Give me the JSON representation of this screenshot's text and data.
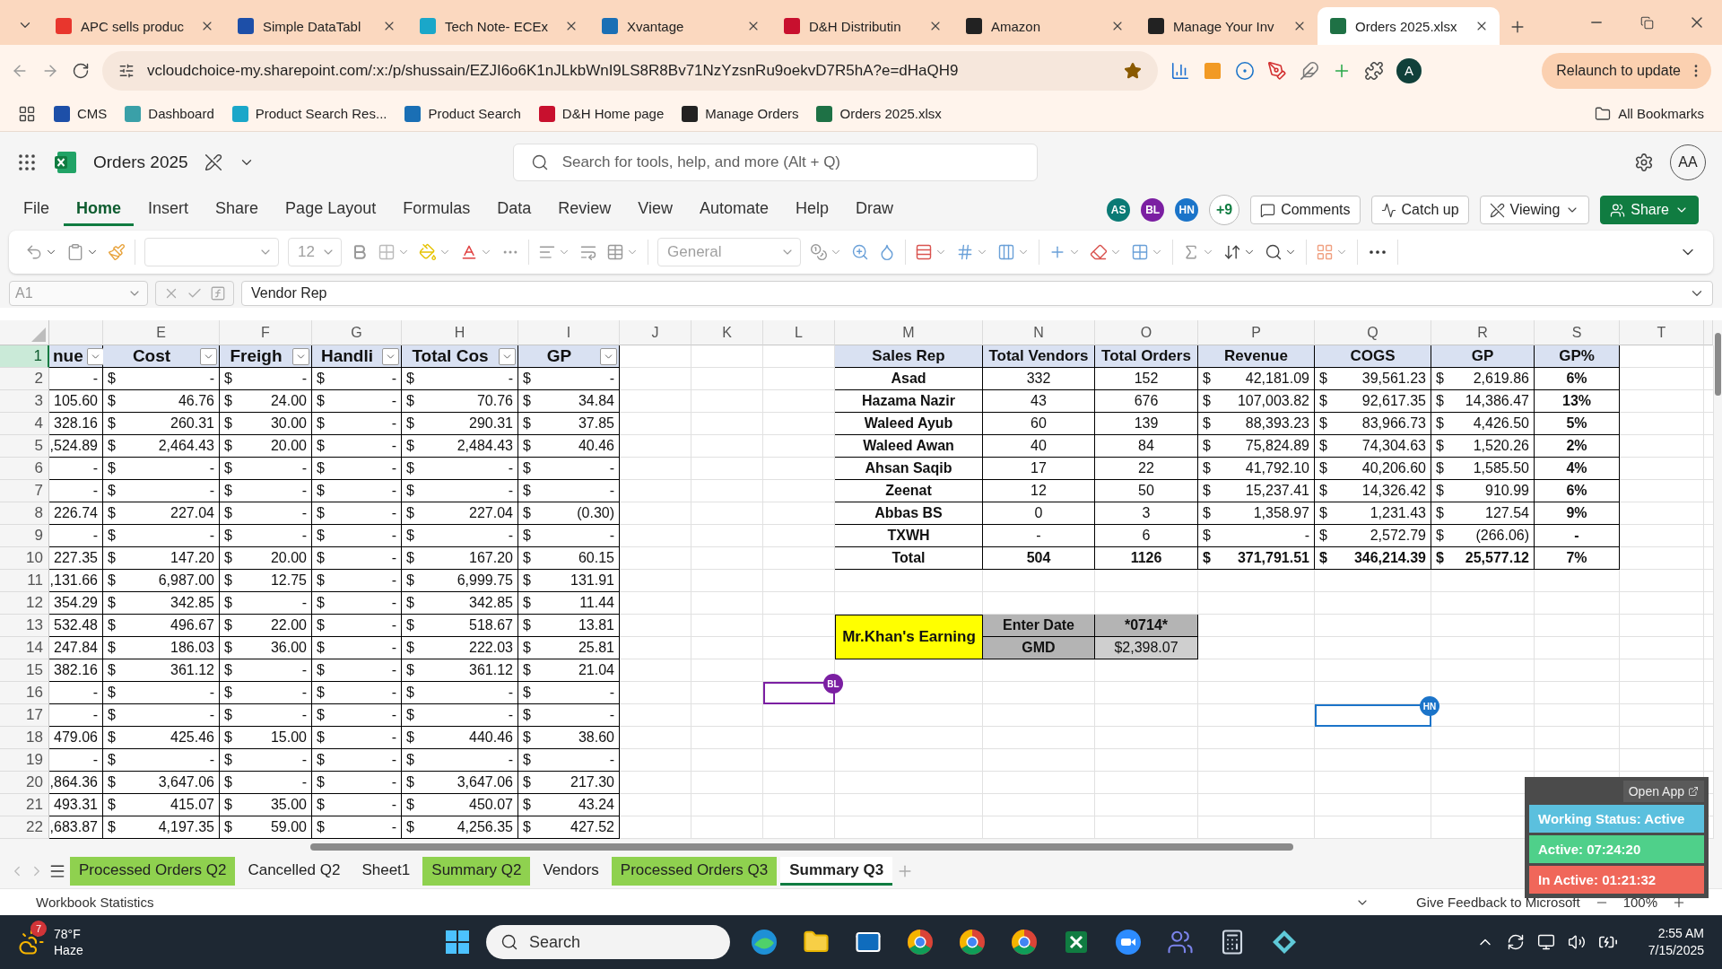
{
  "browser": {
    "tabs": [
      {
        "title": "APC sells produc",
        "color": "#e8362d",
        "selected": false
      },
      {
        "title": "Simple DataTabl",
        "color": "#1d4fa8",
        "selected": false
      },
      {
        "title": "Tech Note- ECEx",
        "color": "#1aa7c9",
        "selected": false
      },
      {
        "title": "Xvantage",
        "color": "#1a6fb5",
        "selected": false
      },
      {
        "title": "D&H Distributin",
        "color": "#c8102e",
        "selected": false
      },
      {
        "title": "Amazon",
        "color": "#222222",
        "selected": false
      },
      {
        "title": "Manage Your Inv",
        "color": "#222222",
        "selected": false
      },
      {
        "title": "Orders 2025.xlsx",
        "color": "#1e7145",
        "selected": true
      }
    ],
    "url": "vcloudchoice-my.sharepoint.com/:x:/p/shussain/EZJI6o6K1nJLkbWnI9LS8R8Bv71NzYzsnRu9oekvD7R5hA?e=dHaQH9",
    "profile": "A",
    "relaunch": "Relaunch to update",
    "bookmarks": [
      {
        "label": "CMS",
        "color": "#1d4fa8"
      },
      {
        "label": "Dashboard",
        "color": "#3aa0a8"
      },
      {
        "label": "Product Search Res...",
        "color": "#1aa7c9"
      },
      {
        "label": "Product Search",
        "color": "#1a6fb5"
      },
      {
        "label": "D&H Home page",
        "color": "#c8102e"
      },
      {
        "label": "Manage Orders",
        "color": "#222222"
      },
      {
        "label": "Orders 2025.xlsx",
        "color": "#1e7145"
      }
    ],
    "all_bookmarks": "All Bookmarks"
  },
  "excel": {
    "file_name": "Orders 2025",
    "search_placeholder": "Search for tools, help, and more (Alt + Q)",
    "account": "AA",
    "menu": [
      {
        "label": "File",
        "selected": false
      },
      {
        "label": "Home",
        "selected": true
      },
      {
        "label": "Insert",
        "selected": false
      },
      {
        "label": "Share",
        "selected": false
      },
      {
        "label": "Page Layout",
        "selected": false
      },
      {
        "label": "Formulas",
        "selected": false
      },
      {
        "label": "Data",
        "selected": false
      },
      {
        "label": "Review",
        "selected": false
      },
      {
        "label": "View",
        "selected": false
      },
      {
        "label": "Automate",
        "selected": false
      },
      {
        "label": "Help",
        "selected": false
      },
      {
        "label": "Draw",
        "selected": false
      }
    ],
    "collaborators": [
      {
        "initials": "AS",
        "color": "#0b7a75"
      },
      {
        "initials": "BL",
        "color": "#7b1fa2"
      },
      {
        "initials": "HN",
        "color": "#1b74c9"
      }
    ],
    "more_collaborators": "+9",
    "actions": [
      "Comments",
      "Catch up",
      "Viewing",
      "Share"
    ],
    "font_size": "12",
    "number_format": "General",
    "name_box": "A1",
    "formula": "Vendor Rep"
  },
  "sheet": {
    "column_letters": [
      "E",
      "F",
      "G",
      "H",
      "I",
      "J",
      "K",
      "L",
      "M",
      "N",
      "O",
      "P",
      "Q",
      "R",
      "S",
      "T"
    ],
    "row_headers": [
      {
        "label": "1",
        "selected": true
      },
      {
        "label": "2",
        "selected": false
      },
      {
        "label": "3",
        "selected": false
      },
      {
        "label": "4",
        "selected": false
      },
      {
        "label": "5",
        "selected": false
      },
      {
        "label": "6",
        "selected": false
      },
      {
        "label": "7",
        "selected": false
      },
      {
        "label": "8",
        "selected": false
      },
      {
        "label": "9",
        "selected": false
      },
      {
        "label": "10",
        "selected": false
      },
      {
        "label": "11",
        "selected": false
      },
      {
        "label": "12",
        "selected": false
      },
      {
        "label": "13",
        "selected": false
      },
      {
        "label": "14",
        "selected": false
      },
      {
        "label": "15",
        "selected": false
      },
      {
        "label": "16",
        "selected": false
      },
      {
        "label": "17",
        "selected": false
      },
      {
        "label": "18",
        "selected": false
      },
      {
        "label": "19",
        "selected": false
      },
      {
        "label": "20",
        "selected": false
      },
      {
        "label": "21",
        "selected": false
      },
      {
        "label": "22",
        "selected": false
      }
    ],
    "data_table": {
      "header": [
        "nue",
        "Cost",
        "Freigh",
        "Handli",
        "Total Cos",
        "GP"
      ],
      "rows": [
        [
          "-",
          "$ -",
          "$ -",
          "$ -",
          "$ -",
          "$ -"
        ],
        [
          "105.60",
          "$ 46.76",
          "$ 24.00",
          "$ -",
          "$ 70.76",
          "$ 34.84"
        ],
        [
          "328.16",
          "$ 260.31",
          "$ 30.00",
          "$ -",
          "$ 290.31",
          "$ 37.85"
        ],
        [
          ",524.89",
          "$ 2,464.43",
          "$ 20.00",
          "$ -",
          "$ 2,484.43",
          "$ 40.46"
        ],
        [
          "-",
          "$ -",
          "$ -",
          "$ -",
          "$ -",
          "$ -"
        ],
        [
          "-",
          "$ -",
          "$ -",
          "$ -",
          "$ -",
          "$ -"
        ],
        [
          "226.74",
          "$ 227.04",
          "$ -",
          "$ -",
          "$ 227.04",
          "$ (0.30)"
        ],
        [
          "-",
          "$ -",
          "$ -",
          "$ -",
          "$ -",
          "$ -"
        ],
        [
          "227.35",
          "$ 147.20",
          "$ 20.00",
          "$ -",
          "$ 167.20",
          "$ 60.15"
        ],
        [
          ",131.66",
          "$ 6,987.00",
          "$ 12.75",
          "$ -",
          "$ 6,999.75",
          "$ 131.91"
        ],
        [
          "354.29",
          "$ 342.85",
          "$ -",
          "$ -",
          "$ 342.85",
          "$ 11.44"
        ],
        [
          "532.48",
          "$ 496.67",
          "$ 22.00",
          "$ -",
          "$ 518.67",
          "$ 13.81"
        ],
        [
          "247.84",
          "$ 186.03",
          "$ 36.00",
          "$ -",
          "$ 222.03",
          "$ 25.81"
        ],
        [
          "382.16",
          "$ 361.12",
          "$ -",
          "$ -",
          "$ 361.12",
          "$ 21.04"
        ],
        [
          "-",
          "$ -",
          "$ -",
          "$ -",
          "$ -",
          "$ -"
        ],
        [
          "-",
          "$ -",
          "$ -",
          "$ -",
          "$ -",
          "$ -"
        ],
        [
          "479.06",
          "$ 425.46",
          "$ 15.00",
          "$ -",
          "$ 440.46",
          "$ 38.60"
        ],
        [
          "-",
          "$ -",
          "$ -",
          "$ -",
          "$ -",
          "$ -"
        ],
        [
          ",864.36",
          "$ 3,647.06",
          "$ -",
          "$ -",
          "$ 3,647.06",
          "$ 217.30"
        ],
        [
          "493.31",
          "$ 415.07",
          "$ 35.00",
          "$ -",
          "$ 450.07",
          "$ 43.24"
        ],
        [
          ",683.87",
          "$ 4,197.35",
          "$ 59.00",
          "$ -",
          "$ 4,256.35",
          "$ 427.52"
        ]
      ]
    },
    "summary": {
      "header": [
        "Sales Rep",
        "Total Vendors",
        "Total Orders",
        "Revenue",
        "COGS",
        "GP",
        "GP%"
      ],
      "rows": [
        [
          "Asad",
          "332",
          "152",
          "$ 42,181.09",
          "$ 39,561.23",
          "$ 2,619.86",
          "6%"
        ],
        [
          "Hazama Nazir",
          "43",
          "676",
          "$ 107,003.82",
          "$ 92,617.35",
          "$ 14,386.47",
          "13%"
        ],
        [
          "Waleed Ayub",
          "60",
          "139",
          "$ 88,393.23",
          "$ 83,966.73",
          "$ 4,426.50",
          "5%"
        ],
        [
          "Waleed Awan",
          "40",
          "84",
          "$ 75,824.89",
          "$ 74,304.63",
          "$ 1,520.26",
          "2%"
        ],
        [
          "Ahsan Saqib",
          "17",
          "22",
          "$ 41,792.10",
          "$ 40,206.60",
          "$ 1,585.50",
          "4%"
        ],
        [
          "Zeenat",
          "12",
          "50",
          "$ 15,237.41",
          "$ 14,326.42",
          "$ 910.99",
          "6%"
        ],
        [
          "Abbas BS",
          "0",
          "3",
          "$ 1,358.97",
          "$ 1,231.43",
          "$ 127.54",
          "9%"
        ],
        [
          "TXWH",
          "-",
          "6",
          "$ -",
          "$ 2,572.79",
          "$ (266.06)",
          "-"
        ]
      ],
      "total": [
        "Total",
        "504",
        "1126",
        "$ 371,791.51",
        "$ 346,214.39",
        "$ 25,577.12",
        "7%"
      ]
    },
    "earning": {
      "title": "Mr.Khan's Earning",
      "labels": [
        "Enter Date",
        "GMD"
      ],
      "values": [
        "*0714*",
        "$2,398.07"
      ]
    },
    "cursors": [
      {
        "initials": "BL",
        "color": "#7b1fa2"
      },
      {
        "initials": "HN",
        "color": "#1b74c9"
      }
    ]
  },
  "sheet_tabs": [
    {
      "label": "Processed Orders Q2",
      "color": "#8fd14f",
      "selected": false
    },
    {
      "label": "Cancelled Q2",
      "selected": false
    },
    {
      "label": "Sheet1",
      "selected": false
    },
    {
      "label": "Summary Q2",
      "color": "#8fd14f",
      "selected": false
    },
    {
      "label": "Vendors",
      "selected": false
    },
    {
      "label": "Processed Orders Q3",
      "color": "#8fd14f",
      "selected": false
    },
    {
      "label": "Summary Q3",
      "selected": true
    }
  ],
  "status_bar": {
    "statistics": "Workbook Statistics",
    "feedback": "Give Feedback to Microsoft",
    "zoom": "100%"
  },
  "tracker": {
    "open_app": "Open App",
    "items": [
      {
        "label": "Working Status: Active",
        "color": "#5bc0de"
      },
      {
        "label": "Active: 07:24:20",
        "color": "#4fd08a"
      },
      {
        "label": "In Active: 01:21:32",
        "color": "#f0675a"
      }
    ]
  },
  "taskbar": {
    "temperature": "78°F",
    "weather": "Haze",
    "badge": "7",
    "search": "Search",
    "time": "2:55 AM",
    "date": "7/15/2025"
  }
}
